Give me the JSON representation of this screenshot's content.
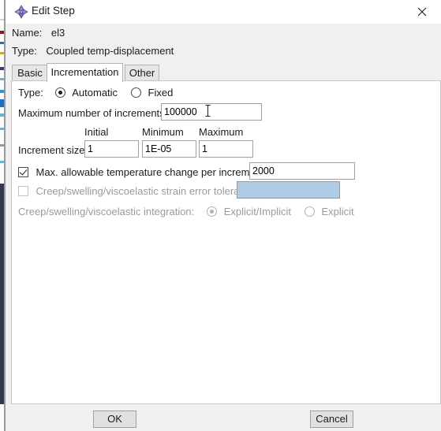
{
  "window": {
    "title": "Edit Step",
    "icon": "abaqus-diamond-icon",
    "close_label": "✕"
  },
  "header": {
    "name_label": "Name:",
    "name_value": "el3",
    "type_label": "Type:",
    "type_value": "Coupled temp-displacement"
  },
  "tabs": [
    {
      "label": "Basic",
      "selected": false
    },
    {
      "label": "Incrementation",
      "selected": true
    },
    {
      "label": "Other",
      "selected": false
    }
  ],
  "form": {
    "type_label": "Type:",
    "type_options": [
      {
        "label": "Automatic",
        "selected": true
      },
      {
        "label": "Fixed",
        "selected": false
      }
    ],
    "max_increments_label": "Maximum number of increments:",
    "max_increments_value": "100000",
    "increment_size_label": "Increment size:",
    "increment_columns": [
      "Initial",
      "Minimum",
      "Maximum"
    ],
    "increment_values": [
      "1",
      "1E-05",
      "1"
    ],
    "max_temp_change": {
      "label": "Max. allowable temperature change per  increment:",
      "checked": true,
      "enabled": true,
      "value": "2000"
    },
    "creep_tolerance": {
      "label": "Creep/swelling/viscoelastic strain error tolerance:",
      "checked": false,
      "enabled": false,
      "value": ""
    },
    "creep_integration": {
      "label": "Creep/swelling/viscoelastic integration:",
      "enabled": false,
      "options": [
        {
          "label": "Explicit/Implicit",
          "selected": true
        },
        {
          "label": "Explicit",
          "selected": false
        }
      ]
    }
  },
  "footer": {
    "ok_label": "OK",
    "cancel_label": "Cancel"
  },
  "colors": {
    "window_bg": "#f0f0f0",
    "panel_bg": "#ffffff",
    "disabled_field_bg": "#aecbe8",
    "tab_bg": "#e6e6e6",
    "border": "#a0a0a0",
    "icon_accent": "#7a79c4"
  }
}
